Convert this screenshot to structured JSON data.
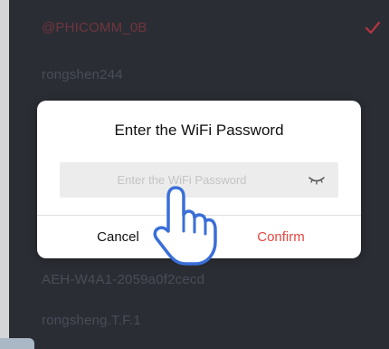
{
  "wifi_list": [
    {
      "ssid": "@PHICOMM_0B",
      "selected": true
    },
    {
      "ssid": "rongshen244",
      "selected": false
    },
    {
      "ssid": "AEH-W4A1-2059a0f2cecd",
      "selected": false
    },
    {
      "ssid": "rongsheng.T.F.1",
      "selected": false
    }
  ],
  "dialog": {
    "title": "Enter the WiFi Password",
    "password_placeholder": "Enter the WiFi Password",
    "password_value": "",
    "cancel_label": "Cancel",
    "confirm_label": "Confirm"
  },
  "colors": {
    "confirm": "#e5473f",
    "selected_check": "#c23a45",
    "background": "#2f3139"
  },
  "icons": {
    "selected": "check-icon",
    "password_visibility": "eye-closed-icon",
    "pointer": "hand-pointer-icon"
  }
}
